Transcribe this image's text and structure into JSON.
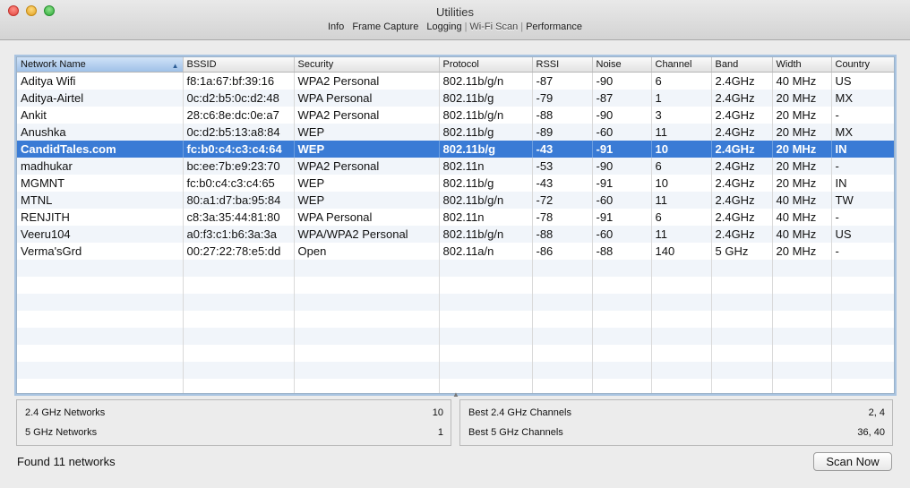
{
  "window": {
    "title": "Utilities",
    "tabs": [
      "Info",
      "Frame Capture",
      "Logging",
      "Wi-Fi Scan",
      "Performance"
    ],
    "active_tab": "Wi-Fi Scan"
  },
  "table": {
    "columns": [
      "Network Name",
      "BSSID",
      "Security",
      "Protocol",
      "RSSI",
      "Noise",
      "Channel",
      "Band",
      "Width",
      "Country"
    ],
    "sorted_column": "Network Name",
    "selected_row": 4,
    "rows": [
      [
        "Aditya Wifi",
        "f8:1a:67:bf:39:16",
        "WPA2 Personal",
        "802.11b/g/n",
        "-87",
        "-90",
        "6",
        "2.4GHz",
        "40 MHz",
        "US"
      ],
      [
        "Aditya-Airtel",
        "0c:d2:b5:0c:d2:48",
        "WPA Personal",
        "802.11b/g",
        "-79",
        "-87",
        "1",
        "2.4GHz",
        "20 MHz",
        "MX"
      ],
      [
        "Ankit",
        "28:c6:8e:dc:0e:a7",
        "WPA2 Personal",
        "802.11b/g/n",
        "-88",
        "-90",
        "3",
        "2.4GHz",
        "20 MHz",
        "-"
      ],
      [
        "Anushka",
        "0c:d2:b5:13:a8:84",
        "WEP",
        "802.11b/g",
        "-89",
        "-60",
        "11",
        "2.4GHz",
        "20 MHz",
        "MX"
      ],
      [
        "CandidTales.com",
        "fc:b0:c4:c3:c4:64",
        "WEP",
        "802.11b/g",
        "-43",
        "-91",
        "10",
        "2.4GHz",
        "20 MHz",
        "IN"
      ],
      [
        "madhukar",
        "bc:ee:7b:e9:23:70",
        "WPA2 Personal",
        "802.11n",
        "-53",
        "-90",
        "6",
        "2.4GHz",
        "20 MHz",
        "-"
      ],
      [
        "MGMNT",
        "fc:b0:c4:c3:c4:65",
        "WEP",
        "802.11b/g",
        "-43",
        "-91",
        "10",
        "2.4GHz",
        "20 MHz",
        "IN"
      ],
      [
        "MTNL",
        "80:a1:d7:ba:95:84",
        "WEP",
        "802.11b/g/n",
        "-72",
        "-60",
        "11",
        "2.4GHz",
        "40 MHz",
        "TW"
      ],
      [
        "RENJITH",
        "c8:3a:35:44:81:80",
        "WPA Personal",
        "802.11n",
        "-78",
        "-91",
        "6",
        "2.4GHz",
        "40 MHz",
        "-"
      ],
      [
        "Veeru104",
        "a0:f3:c1:b6:3a:3a",
        "WPA/WPA2 Personal",
        "802.11b/g/n",
        "-88",
        "-60",
        "11",
        "2.4GHz",
        "40 MHz",
        "US"
      ],
      [
        "Verma'sGrd",
        "00:27:22:78:e5:dd",
        "Open",
        "802.11a/n",
        "-86",
        "-88",
        "140",
        "5 GHz",
        "20 MHz",
        "-"
      ]
    ],
    "empty_rows": 8
  },
  "summary": {
    "ghz24_label": "2.4 GHz Networks",
    "ghz24_value": "10",
    "ghz5_label": "5 GHz Networks",
    "ghz5_value": "1",
    "best24_label": "Best 2.4 GHz Channels",
    "best24_value": "2, 4",
    "best5_label": "Best 5 GHz Channels",
    "best5_value": "36, 40"
  },
  "status": "Found 11 networks",
  "scan_button": "Scan Now"
}
